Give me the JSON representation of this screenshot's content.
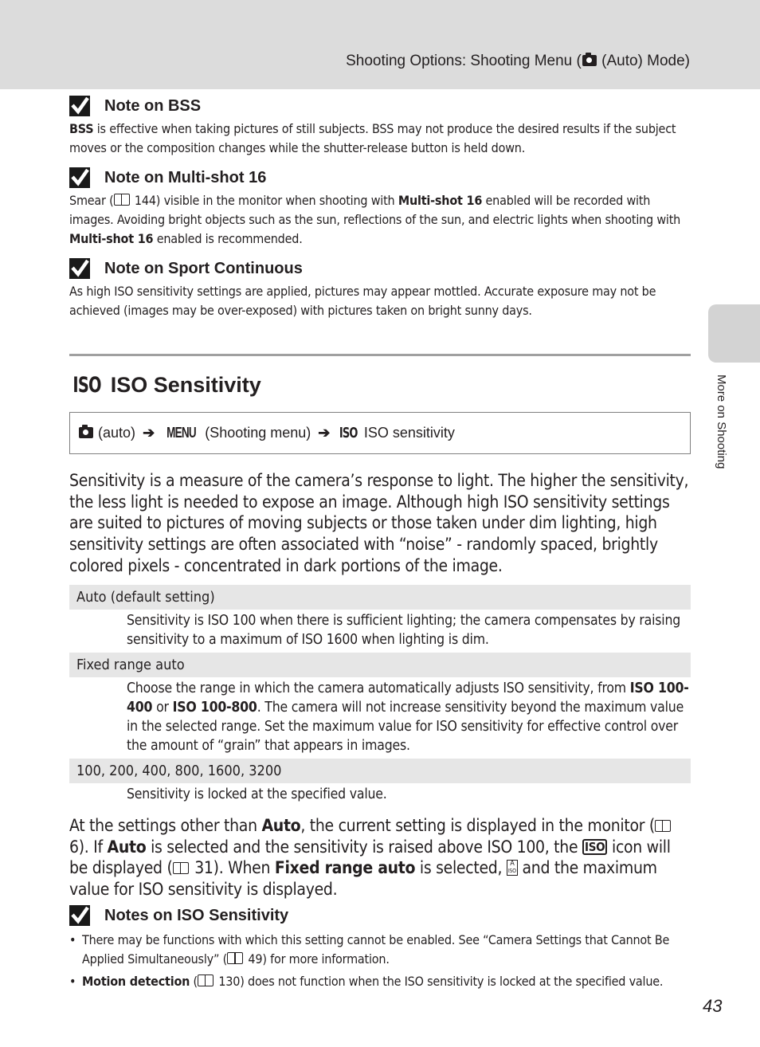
{
  "header": {
    "title_prefix": "Shooting Options: Shooting Menu (",
    "title_icon": "camera-auto-icon",
    "title_suffix": " (Auto) Mode)"
  },
  "side_tab": {
    "label": "More on Shooting"
  },
  "notes_top": [
    {
      "title": "Note on BSS",
      "body_parts": [
        {
          "bold": true,
          "text": "BSS"
        },
        {
          "bold": false,
          "text": " is effective when taking pictures of still subjects. BSS may not produce the desired results if the subject moves or the composition changes while the shutter-release button is held down."
        }
      ]
    },
    {
      "title": "Note on Multi-shot 16",
      "body_parts": [
        {
          "bold": false,
          "text": "Smear ("
        },
        {
          "icon": "book-icon"
        },
        {
          "bold": false,
          "text": " 144) visible in the monitor when shooting with "
        },
        {
          "bold": true,
          "text": "Multi-shot 16"
        },
        {
          "bold": false,
          "text": " enabled will be recorded with images. Avoiding bright objects such as the sun, reflections of the sun, and electric lights when shooting with "
        },
        {
          "bold": true,
          "text": "Multi-shot 16"
        },
        {
          "bold": false,
          "text": " enabled is recommended."
        }
      ]
    },
    {
      "title": "Note on Sport Continuous",
      "body_parts": [
        {
          "bold": false,
          "text": "As high ISO sensitivity settings are applied, pictures may appear mottled. Accurate exposure may not be achieved (images may be over-exposed) with pictures taken on bright sunny days."
        }
      ]
    }
  ],
  "section": {
    "icon_text": "ISO",
    "title": "ISO Sensitivity",
    "path": {
      "mode_label": "(auto)",
      "menu_glyph": "MENU",
      "menu_label": "(Shooting menu)",
      "iso_glyph": "ISO",
      "item_label": "ISO sensitivity",
      "arrow": "➔"
    },
    "intro": "Sensitivity is a measure of the camera’s response to light. The higher the sensitivity, the less light is needed to expose an image. Although high ISO sensitivity settings are suited to pictures of moving subjects or those taken under dim lighting, high sensitivity settings are often associated with “noise” - randomly spaced, brightly colored pixels - concentrated in dark portions of the image."
  },
  "options": [
    {
      "name": "Auto (default setting)",
      "desc_parts": [
        {
          "bold": false,
          "text": "Sensitivity is ISO 100 when there is sufficient lighting; the camera compensates by raising sensitivity to a maximum of ISO 1600 when lighting is dim."
        }
      ]
    },
    {
      "name": "Fixed range auto",
      "desc_parts": [
        {
          "bold": false,
          "text": "Choose the range in which the camera automatically adjusts ISO sensitivity, from "
        },
        {
          "bold": true,
          "text": "ISO 100-400"
        },
        {
          "bold": false,
          "text": " or "
        },
        {
          "bold": true,
          "text": "ISO 100-800"
        },
        {
          "bold": false,
          "text": ". The camera will not increase sensitivity beyond the maximum value in the selected range. Set the maximum value for ISO sensitivity for effective control over the amount of “grain” that appears in images."
        }
      ]
    },
    {
      "name": "100, 200, 400, 800, 1600, 3200",
      "desc_parts": [
        {
          "bold": false,
          "text": "Sensitivity is locked at the specified value."
        }
      ]
    }
  ],
  "after_parts": [
    {
      "bold": false,
      "text": "At the settings other than "
    },
    {
      "bold": true,
      "text": "Auto"
    },
    {
      "bold": false,
      "text": ", the current setting is displayed in the monitor ("
    },
    {
      "icon": "book-icon"
    },
    {
      "bold": false,
      "text": " 6). If "
    },
    {
      "bold": true,
      "text": "Auto"
    },
    {
      "bold": false,
      "text": " is selected and the sensitivity is raised above ISO 100, the "
    },
    {
      "icon": "iso-box-icon",
      "text": "ISO"
    },
    {
      "bold": false,
      "text": " icon will be displayed ("
    },
    {
      "icon": "book-icon"
    },
    {
      "bold": false,
      "text": " 31). When "
    },
    {
      "bold": true,
      "text": "Fixed range auto"
    },
    {
      "bold": false,
      "text": " is selected, "
    },
    {
      "icon": "auto-iso-icon",
      "text": "A"
    },
    {
      "bold": false,
      "text": " and the maximum value for ISO sensitivity is displayed."
    }
  ],
  "notes_iso": {
    "title": "Notes on ISO Sensitivity",
    "bullets": [
      [
        {
          "bold": false,
          "text": "There may be functions with which this setting cannot be enabled. See “Camera Settings that Cannot Be Applied Simultaneously” ("
        },
        {
          "icon": "book-icon"
        },
        {
          "bold": false,
          "text": " 49) for more information."
        }
      ],
      [
        {
          "bold": true,
          "text": "Motion detection"
        },
        {
          "bold": false,
          "text": " ("
        },
        {
          "icon": "book-icon"
        },
        {
          "bold": false,
          "text": " 130) does not function when the ISO sensitivity is locked at the specified value."
        }
      ]
    ]
  },
  "page_number": "43"
}
